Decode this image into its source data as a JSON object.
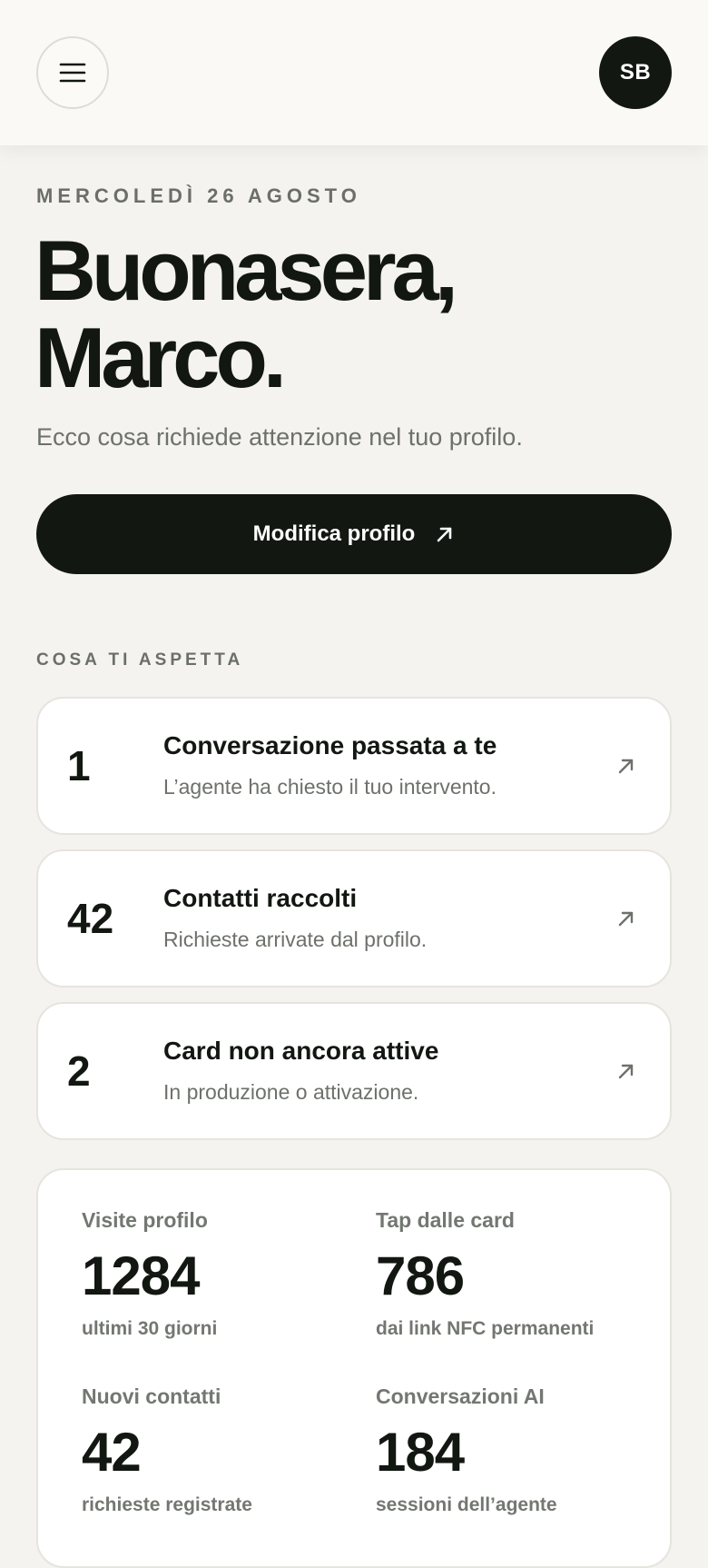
{
  "header": {
    "menu_icon": "hamburger-menu-icon",
    "avatar_initials": "SB"
  },
  "hero": {
    "date": "MERCOLEDÌ 26 AGOSTO",
    "greeting_line1": "Buonasera,",
    "greeting_line2": "Marco.",
    "subtitle": "Ecco cosa richiede attenzione nel tuo profilo.",
    "cta_label": "Modifica profilo",
    "cta_icon": "arrow-up-right-icon"
  },
  "tasks": {
    "section_label": "COSA TI ASPETTA",
    "items": [
      {
        "count": "1",
        "title": "Conversazione passata a te",
        "description": "L’agente ha chiesto il tuo intervento."
      },
      {
        "count": "42",
        "title": "Contatti raccolti",
        "description": "Richieste arrivate dal profilo."
      },
      {
        "count": "2",
        "title": "Card non ancora attive",
        "description": "In produzione o attivazione."
      }
    ]
  },
  "stats": [
    {
      "label": "Visite profilo",
      "value": "1284",
      "note": "ultimi 30 giorni"
    },
    {
      "label": "Tap dalle card",
      "value": "786",
      "note": "dai link NFC permanenti"
    },
    {
      "label": "Nuovi contatti",
      "value": "42",
      "note": "richieste registrate"
    },
    {
      "label": "Conversazioni AI",
      "value": "184",
      "note": "sessioni dell’agente"
    }
  ],
  "colors": {
    "background": "#f4f3ef",
    "header": "#faf9f5",
    "ink": "#121712",
    "muted": "#6d716a"
  }
}
